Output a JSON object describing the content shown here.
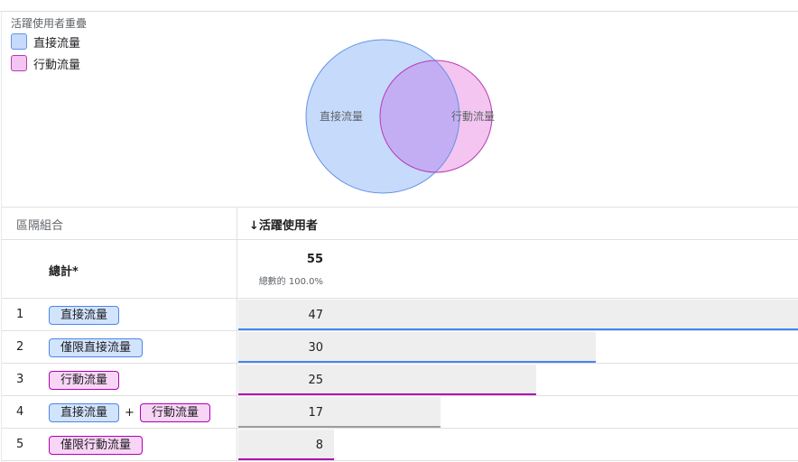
{
  "chart_data": [
    {
      "type": "venn",
      "title": "活躍使用者重疊",
      "legend": [
        {
          "label": "直接流量",
          "fill": "#c6dafc",
          "stroke": "#6493e6"
        },
        {
          "label": "行動流量",
          "fill": "#f3c5f0",
          "stroke": "#b53bb5"
        }
      ],
      "sets": [
        {
          "label": "直接流量",
          "value": 47,
          "fill": "#c6dafc",
          "stroke": "#6493e6"
        },
        {
          "label": "行動流量",
          "value": 25,
          "fill": "#f3c5f0",
          "stroke": "#b53bb5"
        }
      ],
      "overlap": 17,
      "overlap_fill": "#c4aef3"
    },
    {
      "type": "table",
      "columns": [
        "區隔組合",
        "↓活躍使用者"
      ],
      "total": {
        "label": "總計*",
        "value": 55,
        "percent": "總數的 100.0%"
      },
      "max_value": 47,
      "rows": [
        {
          "index": "1",
          "segments": [
            {
              "label": "直接流量",
              "kind": "direct"
            }
          ],
          "value": 47,
          "line_color": "#4285f4"
        },
        {
          "index": "2",
          "segments": [
            {
              "label": "僅限直接流量",
              "kind": "direct"
            }
          ],
          "value": 30,
          "line_color": "#4285f4"
        },
        {
          "index": "3",
          "segments": [
            {
              "label": "行動流量",
              "kind": "mobile"
            }
          ],
          "value": 25,
          "line_color": "#b000b5"
        },
        {
          "index": "4",
          "segments": [
            {
              "label": "直接流量",
              "kind": "direct"
            },
            {
              "label": "行動流量",
              "kind": "mobile"
            }
          ],
          "joiner": "+",
          "value": 17,
          "line_color": "#9e9e9e"
        },
        {
          "index": "5",
          "segments": [
            {
              "label": "僅限行動流量",
              "kind": "mobile"
            }
          ],
          "value": 8,
          "line_color": "#b000b5"
        }
      ]
    }
  ]
}
